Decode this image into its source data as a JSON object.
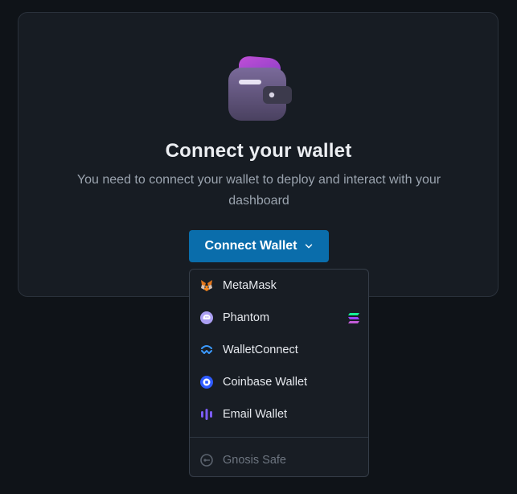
{
  "card": {
    "title": "Connect your wallet",
    "subtitle": "You need to connect your wallet to deploy and interact with your dashboard"
  },
  "connect_button": {
    "label": "Connect Wallet"
  },
  "wallet_menu": {
    "items": [
      {
        "label": "MetaMask",
        "icon": "metamask-fox-icon"
      },
      {
        "label": "Phantom",
        "icon": "phantom-ghost-icon",
        "badge_icon": "solana-icon"
      },
      {
        "label": "WalletConnect",
        "icon": "walletconnect-icon"
      },
      {
        "label": "Coinbase Wallet",
        "icon": "coinbase-icon"
      },
      {
        "label": "Email Wallet",
        "icon": "email-wallet-icon"
      }
    ],
    "disabled_items": [
      {
        "label": "Gnosis Safe",
        "icon": "gnosis-safe-icon"
      }
    ]
  },
  "colors": {
    "page_bg": "#0f1318",
    "card_bg": "#171c23",
    "accent": "#0a6dab",
    "text_primary": "#eceef2",
    "text_muted": "#9aa3ae"
  }
}
